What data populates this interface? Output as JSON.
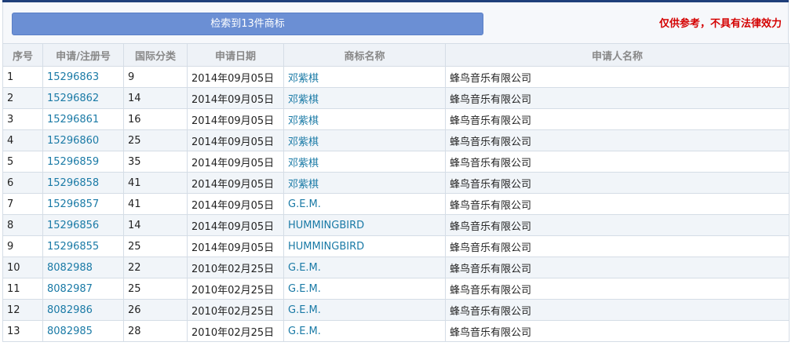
{
  "summary": {
    "result_label": "检索到13件商标",
    "disclaimer": "仅供参考，不具有法律效力"
  },
  "table": {
    "columns": [
      "序号",
      "申请/注册号",
      "国际分类",
      "申请日期",
      "商标名称",
      "申请人名称"
    ],
    "rows": [
      {
        "idx": "1",
        "reg_no": "15296863",
        "class": "9",
        "date": "2014年09月05日",
        "name": "邓紫棋",
        "applicant": "蜂鸟音乐有限公司"
      },
      {
        "idx": "2",
        "reg_no": "15296862",
        "class": "14",
        "date": "2014年09月05日",
        "name": "邓紫棋",
        "applicant": "蜂鸟音乐有限公司"
      },
      {
        "idx": "3",
        "reg_no": "15296861",
        "class": "16",
        "date": "2014年09月05日",
        "name": "邓紫棋",
        "applicant": "蜂鸟音乐有限公司"
      },
      {
        "idx": "4",
        "reg_no": "15296860",
        "class": "25",
        "date": "2014年09月05日",
        "name": "邓紫棋",
        "applicant": "蜂鸟音乐有限公司"
      },
      {
        "idx": "5",
        "reg_no": "15296859",
        "class": "35",
        "date": "2014年09月05日",
        "name": "邓紫棋",
        "applicant": "蜂鸟音乐有限公司"
      },
      {
        "idx": "6",
        "reg_no": "15296858",
        "class": "41",
        "date": "2014年09月05日",
        "name": "邓紫棋",
        "applicant": "蜂鸟音乐有限公司"
      },
      {
        "idx": "7",
        "reg_no": "15296857",
        "class": "41",
        "date": "2014年09月05日",
        "name": "G.E.M.",
        "applicant": "蜂鸟音乐有限公司"
      },
      {
        "idx": "8",
        "reg_no": "15296856",
        "class": "14",
        "date": "2014年09月05日",
        "name": "HUMMINGBIRD",
        "applicant": "蜂鸟音乐有限公司"
      },
      {
        "idx": "9",
        "reg_no": "15296855",
        "class": "25",
        "date": "2014年09月05日",
        "name": "HUMMINGBIRD",
        "applicant": "蜂鸟音乐有限公司"
      },
      {
        "idx": "10",
        "reg_no": "8082988",
        "class": "22",
        "date": "2010年02月25日",
        "name": "G.E.M.",
        "applicant": "蜂鸟音乐有限公司"
      },
      {
        "idx": "11",
        "reg_no": "8082987",
        "class": "25",
        "date": "2010年02月25日",
        "name": "G.E.M.",
        "applicant": "蜂鸟音乐有限公司"
      },
      {
        "idx": "12",
        "reg_no": "8082986",
        "class": "26",
        "date": "2010年02月25日",
        "name": "G.E.M.",
        "applicant": "蜂鸟音乐有限公司"
      },
      {
        "idx": "13",
        "reg_no": "8082985",
        "class": "28",
        "date": "2010年02月25日",
        "name": "G.E.M.",
        "applicant": "蜂鸟音乐有限公司"
      }
    ]
  },
  "colors": {
    "bar_blue": "#6b8fd4",
    "link": "#1a7aa6",
    "disclaimer_red": "#d40000",
    "top_rule": "#1f3f7a",
    "stripe": "#f1f5f9",
    "header_bg": "#eef2f7"
  }
}
